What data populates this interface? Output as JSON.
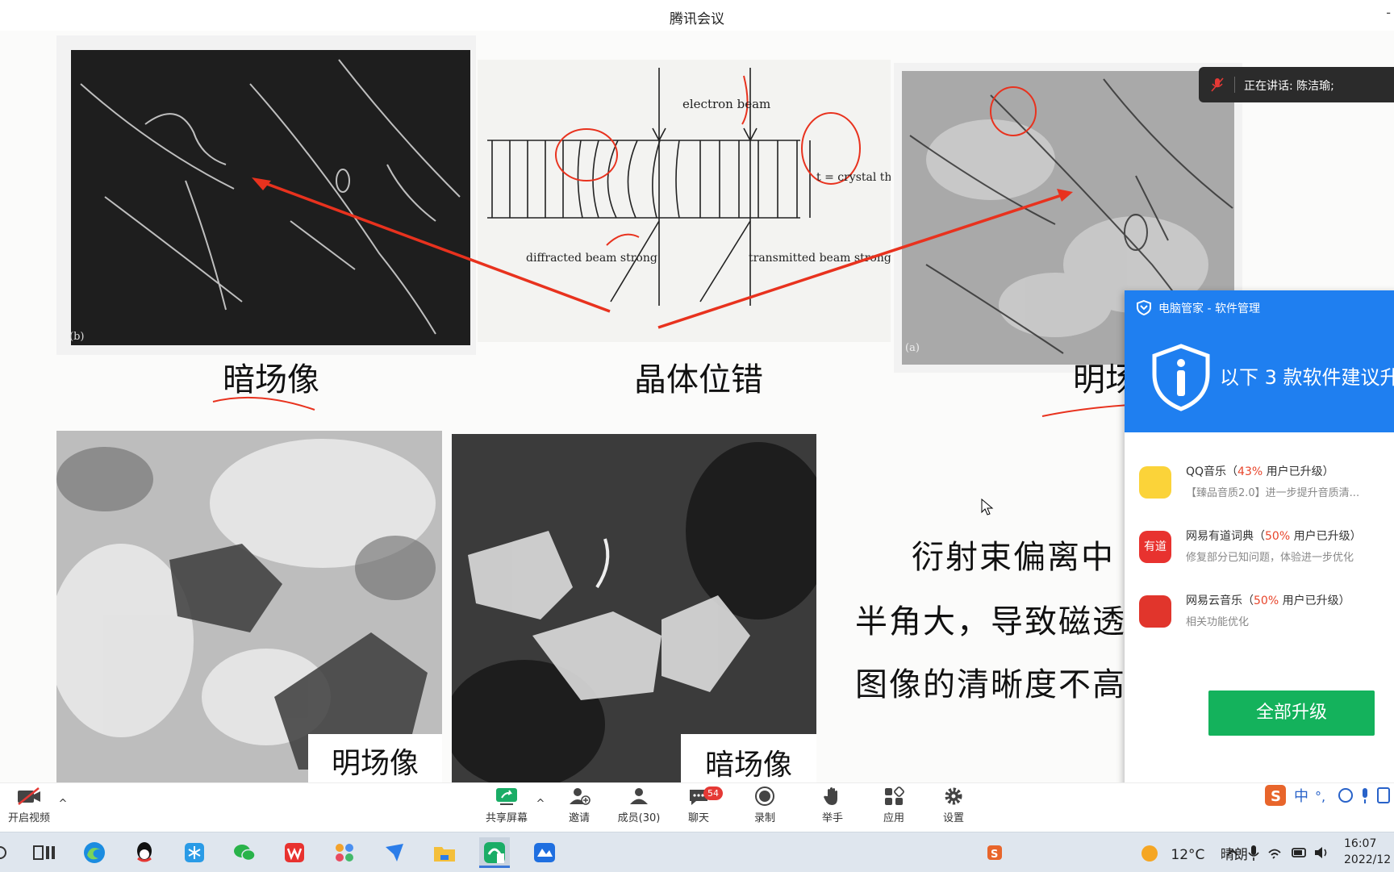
{
  "window": {
    "title": "腾讯会议",
    "corner": "-"
  },
  "slide": {
    "top_images": {
      "dark_label": "(b)",
      "bright_label": "(a)",
      "diagram": {
        "electron_beam": "electron beam",
        "crystal_thickness": "t = crystal thickness",
        "diffracted": "diffracted beam strong",
        "transmitted": "transmitted beam strong"
      }
    },
    "captions": {
      "dark_field": "暗场像",
      "dislocation": "晶体位错",
      "bright_field": "明场"
    },
    "bottom_labels": {
      "left": "明场像",
      "right": "暗场像"
    },
    "text_lines": [
      "衍射束偏离中",
      "半角大，导致磁透",
      "图像的清晰度不高"
    ]
  },
  "speaker": {
    "label": "正在讲话: 陈洁瑜;"
  },
  "popup": {
    "title": "电脑管家 - 软件管理",
    "headline": "以下 3 款软件建议升",
    "apps": [
      {
        "name": "QQ音乐",
        "pct": "43%",
        "suffix": " 用户已升级",
        "desc": "【臻品音质2.0】进一步提升音质清...",
        "icon": "qq-music-icon",
        "color": "#fbd339"
      },
      {
        "name": "网易有道词典",
        "pct": "50%",
        "suffix": " 用户已升级",
        "desc": "修复部分已知问题，体验进一步优化",
        "icon": "youdao-icon",
        "color": "#e8322f"
      },
      {
        "name": "网易云音乐",
        "pct": "50%",
        "suffix": " 用户已升级",
        "desc": "相关功能优化",
        "icon": "netease-music-icon",
        "color": "#e1352c"
      }
    ],
    "button": "全部升级"
  },
  "toolbar": {
    "video": "开启视频",
    "share": "共享屏幕",
    "invite": "邀请",
    "members": "成员(30)",
    "chat": "聊天",
    "chat_badge": "54",
    "record": "录制",
    "raise_hand": "举手",
    "apps": "应用",
    "settings": "设置"
  },
  "ime": {
    "mode": "中"
  },
  "taskbar": {
    "weather_temp": "12°C",
    "weather_desc": "晴朗",
    "time": "16:07",
    "date": "2022/12"
  }
}
